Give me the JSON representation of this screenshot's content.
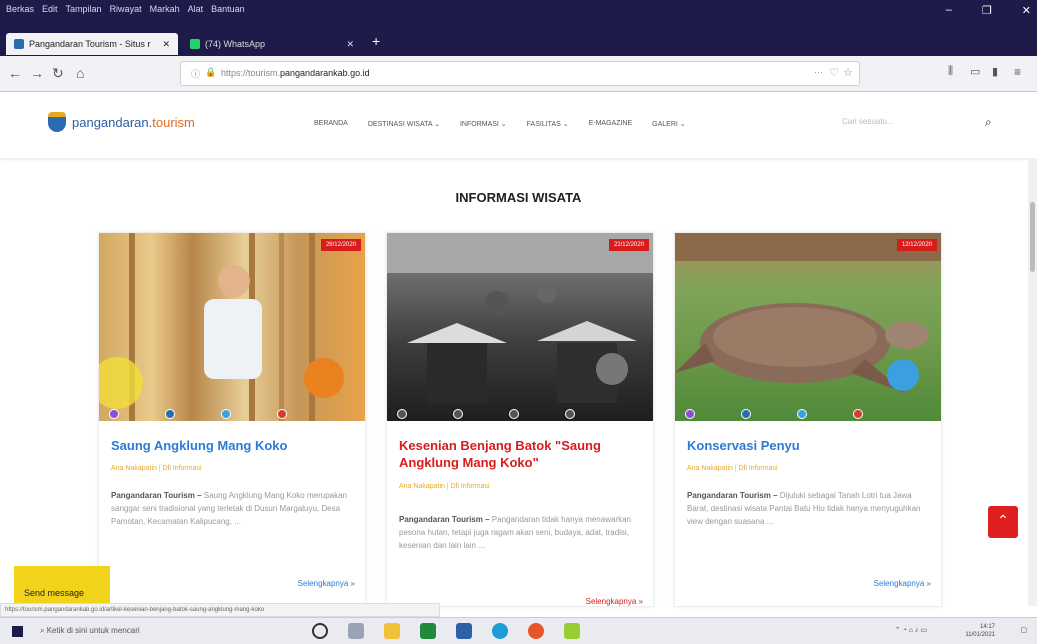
{
  "browser": {
    "menu": [
      "Berkas",
      "Edit",
      "Tampilan",
      "Riwayat",
      "Markah",
      "Alat",
      "Bantuan"
    ],
    "tabs": [
      {
        "title": "Pangandaran Tourism - Situs r",
        "active": true
      },
      {
        "title": "(74) WhatsApp",
        "active": false
      }
    ],
    "url_prefix": "https://tourism.",
    "url_domain": "pangandarankab.go.id",
    "more_glyph": "···"
  },
  "site": {
    "logo_text_1": "pangandaran.",
    "logo_text_2": "tourism",
    "nav": [
      "BERANDA",
      "DESTINASI WISATA ⌄",
      "INFORMASI ⌄",
      "FASILITAS ⌄",
      "E-MAGAZINE",
      "GALERI ⌄"
    ],
    "search_placeholder": "Cari sesuatu...",
    "section_title": "INFORMASI WISATA"
  },
  "cards": [
    {
      "date": "28/12/2020",
      "title": "Saung Angklung Mang Koko",
      "title_color": "#2b7bd8",
      "meta": "Ana Nakapatin | Dll Informasi",
      "lead": "Pangandaran Tourism –",
      "excerpt": "Saung Angklung Mang Koko merupakan sanggar seni tradisional yang terletak di Dusun Margaluyu, Desa Pamotan, Kecamatan Kalipucang, ...",
      "more": "Selengkapnya »",
      "more_color": "#2b7bd8"
    },
    {
      "date": "22/12/2020",
      "title": "Kesenian Benjang Batok \"Saung Angklung Mang Koko\"",
      "title_color": "#d81c1c",
      "meta": "Ana Nakapatin | Dll Informasi",
      "lead": "Pangandaran Tourism –",
      "excerpt": "Pangandaran tidak hanya menawarkan pesona hutan, tetapi juga ragam akan seni, budaya, adat, tradisi, kesenian dan lain lain ...",
      "more": "Selengkapnya »",
      "more_color": "#d81c1c"
    },
    {
      "date": "12/12/2020",
      "title": "Konservasi Penyu",
      "title_color": "#2b7bd8",
      "meta": "Ana Nakapatin | Dll Informasi",
      "lead": "Pangandaran Tourism –",
      "excerpt": "Dijuluki sebagai Tanah Lotri tua Jawa Barat, destinasi wisata Pantai Batu Hiu tidak hanya menyuguhkan view dengan suasana ...",
      "more": "Selengkapnya »",
      "more_color": "#2b7bd8"
    }
  ],
  "chat": {
    "label": "Send message"
  },
  "status_url": "https://tourism.pangandarankab.go.id/artikel-kesenian-benjang-batok-saung-angklung-mang-koko",
  "taskbar": {
    "search": "Ketik di sini untuk mencari",
    "time": "14:17",
    "date": "11/01/2021"
  }
}
